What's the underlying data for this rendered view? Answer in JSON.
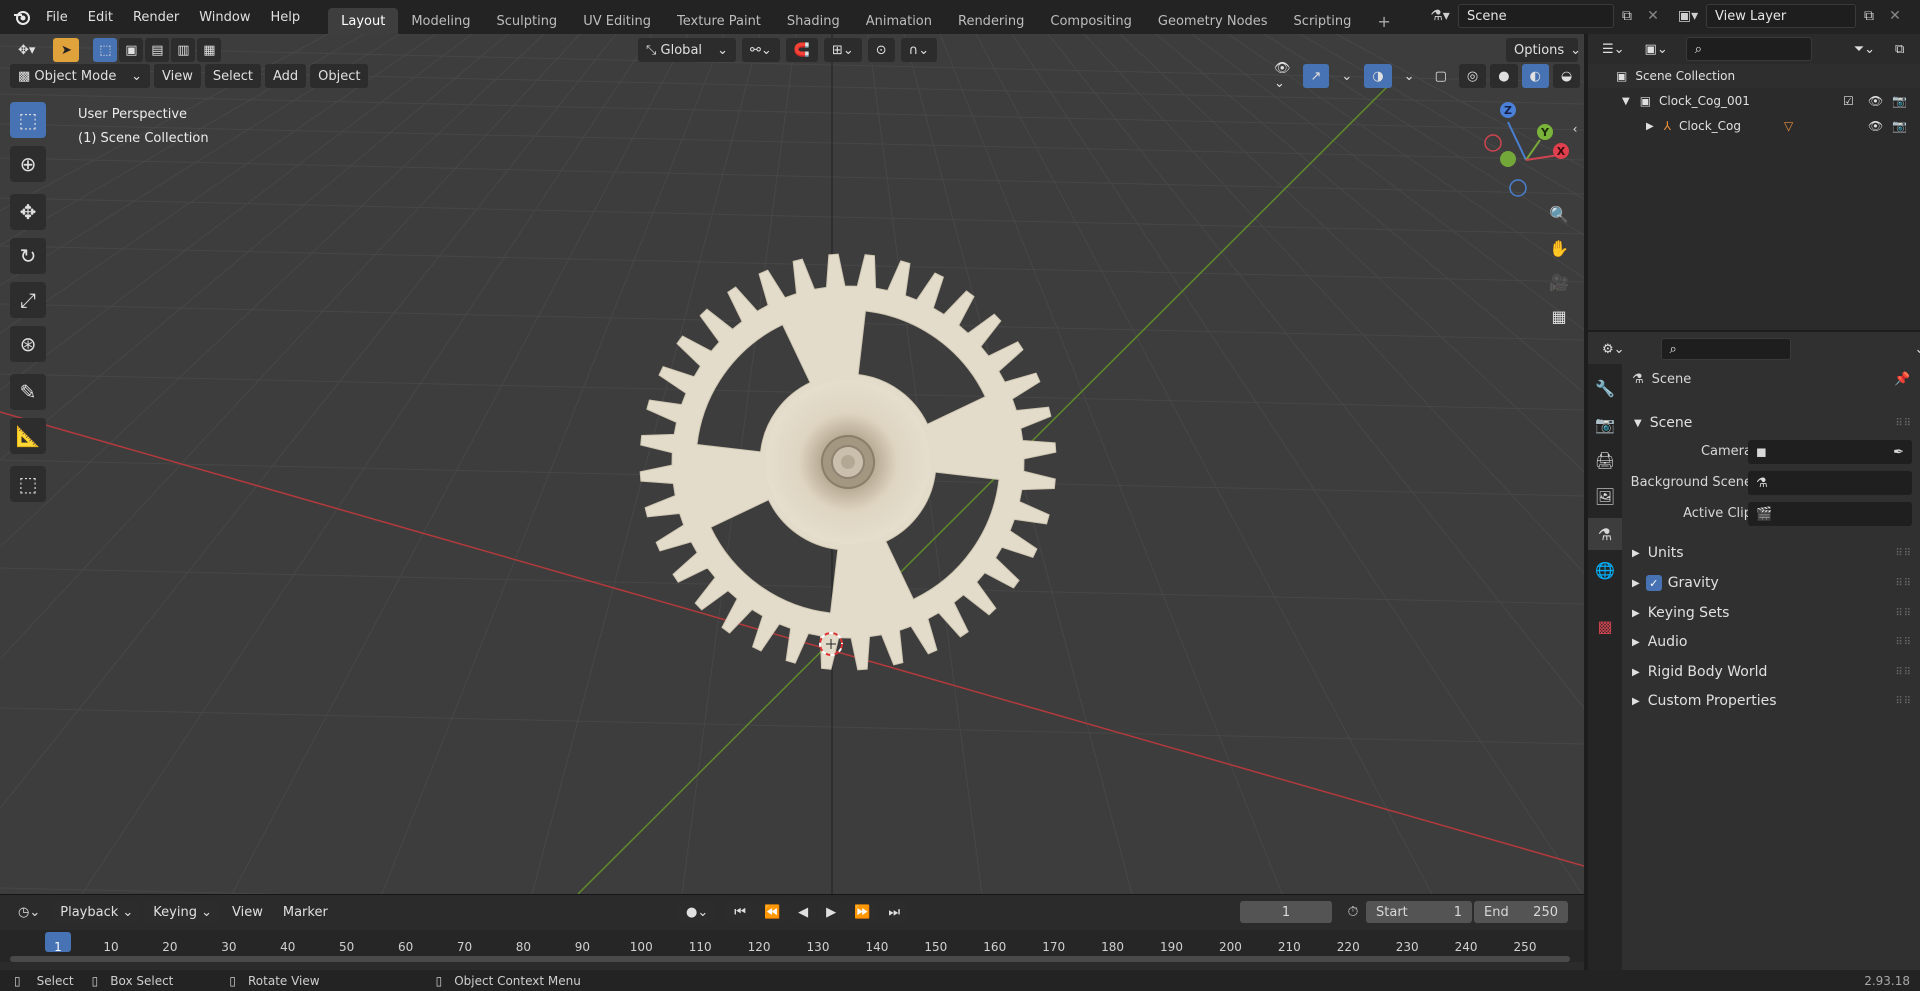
{
  "app": {
    "logo_icon": "blender-logo-icon"
  },
  "menu": [
    "File",
    "Edit",
    "Render",
    "Window",
    "Help"
  ],
  "workspaces": {
    "tabs": [
      "Layout",
      "Modeling",
      "Sculpting",
      "UV Editing",
      "Texture Paint",
      "Shading",
      "Animation",
      "Rendering",
      "Compositing",
      "Geometry Nodes",
      "Scripting"
    ],
    "active": "Layout",
    "add_icon": "plus-icon"
  },
  "scene_selector": {
    "value": "Scene"
  },
  "view_layer": {
    "value": "View Layer"
  },
  "viewport": {
    "mode": "Object Mode",
    "header_menus": [
      "View",
      "Select",
      "Add",
      "Object"
    ],
    "transform_orientation": "Global",
    "options_label": "Options",
    "overlay_text": {
      "perspective": "User Perspective",
      "collection": "(1) Scene Collection"
    },
    "tools": [
      "select-box-icon",
      "cursor-icon",
      "move-icon",
      "rotate-icon",
      "scale-icon",
      "transform-icon",
      "annotate-icon",
      "measure-icon",
      "add-cube-icon"
    ],
    "nav_gizmo": {
      "x": "X",
      "y": "Y",
      "z": "Z"
    },
    "colors": {
      "x_axis": "#c0393b",
      "y_axis": "#6a9a2a",
      "background": "#3d3d3d",
      "accent": "#4772b3"
    }
  },
  "timeline": {
    "menus": [
      "Playback",
      "Keying",
      "View",
      "Marker"
    ],
    "current_frame": "1",
    "start_label": "Start",
    "start_value": "1",
    "end_label": "End",
    "end_value": "250",
    "ticks": [
      "1",
      "10",
      "20",
      "30",
      "40",
      "50",
      "60",
      "70",
      "80",
      "90",
      "100",
      "110",
      "120",
      "130",
      "140",
      "150",
      "160",
      "170",
      "180",
      "190",
      "200",
      "210",
      "220",
      "230",
      "240",
      "250"
    ]
  },
  "statusbar": {
    "select": "Select",
    "box_select": "Box Select",
    "rotate_view": "Rotate View",
    "context_menu": "Object Context Menu",
    "version": "2.93.18"
  },
  "outliner": {
    "root": "Scene Collection",
    "collection": "Clock_Cog_001",
    "object": "Clock_Cog"
  },
  "properties": {
    "context": "Scene",
    "panel_title": "Scene",
    "fields": {
      "camera_label": "Camera",
      "background_scene_label": "Background Scene",
      "active_clip_label": "Active Clip"
    },
    "collapsed_panels": {
      "units": "Units",
      "gravity": "Gravity",
      "keying_sets": "Keying Sets",
      "audio": "Audio",
      "rigid_body_world": "Rigid Body World",
      "custom_properties": "Custom Properties"
    },
    "gravity_checked": true,
    "tabs": [
      "tool-icon",
      "render-icon",
      "output-icon",
      "view-layer-icon",
      "scene-icon",
      "world-icon",
      "texture-icon"
    ]
  }
}
